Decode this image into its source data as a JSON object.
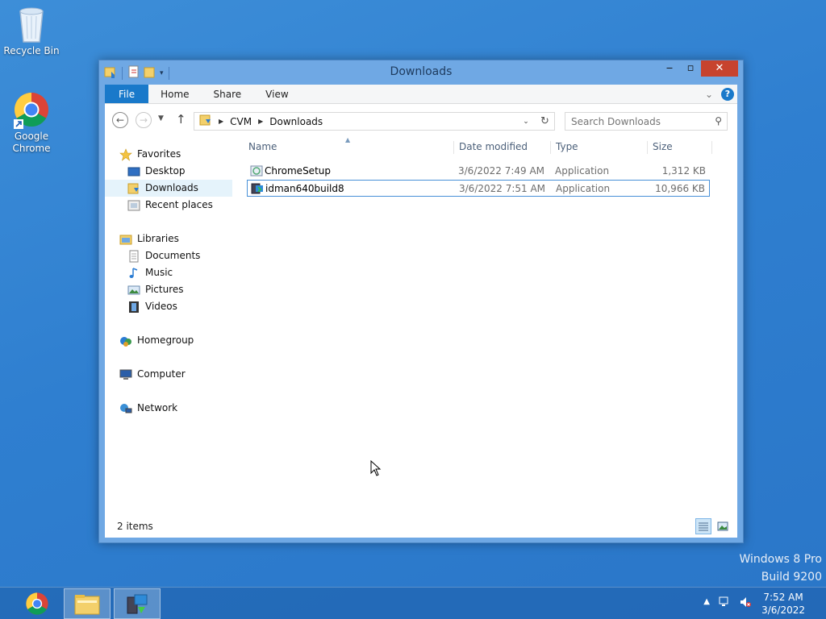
{
  "desktop": {
    "icons": [
      {
        "label": "Recycle Bin",
        "icon": "recycle-bin-icon"
      },
      {
        "label": "Google\nChrome",
        "icon": "chrome-icon"
      }
    ],
    "watermark": {
      "line1": "Windows 8 Pro",
      "line2": "Build 9200"
    }
  },
  "window": {
    "title": "Downloads",
    "ribbon": {
      "tabs": [
        "File",
        "Home",
        "Share",
        "View"
      ]
    },
    "address": {
      "crumbs": [
        "CVM",
        "Downloads"
      ]
    },
    "search": {
      "placeholder": "Search Downloads"
    },
    "nav": {
      "favorites": "Favorites",
      "favorites_items": [
        "Desktop",
        "Downloads",
        "Recent places"
      ],
      "libraries": "Libraries",
      "libraries_items": [
        "Documents",
        "Music",
        "Pictures",
        "Videos"
      ],
      "homegroup": "Homegroup",
      "computer": "Computer",
      "network": "Network",
      "selected": "Downloads"
    },
    "columns": {
      "name": "Name",
      "date": "Date modified",
      "type": "Type",
      "size": "Size"
    },
    "files": [
      {
        "name": "ChromeSetup",
        "date": "3/6/2022 7:49 AM",
        "type": "Application",
        "size": "1,312 KB"
      },
      {
        "name": "idman640build8",
        "date": "3/6/2022 7:51 AM",
        "type": "Application",
        "size": "10,966 KB"
      }
    ],
    "status": {
      "count": "2 items"
    }
  },
  "taskbar": {
    "clock": {
      "time": "7:52 AM",
      "date": "3/6/2022"
    }
  },
  "colors": {
    "desktop": "#2f7fd0",
    "window_frame": "#6fa8e4",
    "ribbon_file": "#1979ca",
    "close_button": "#c7432e",
    "selection_border": "#4790d8"
  }
}
